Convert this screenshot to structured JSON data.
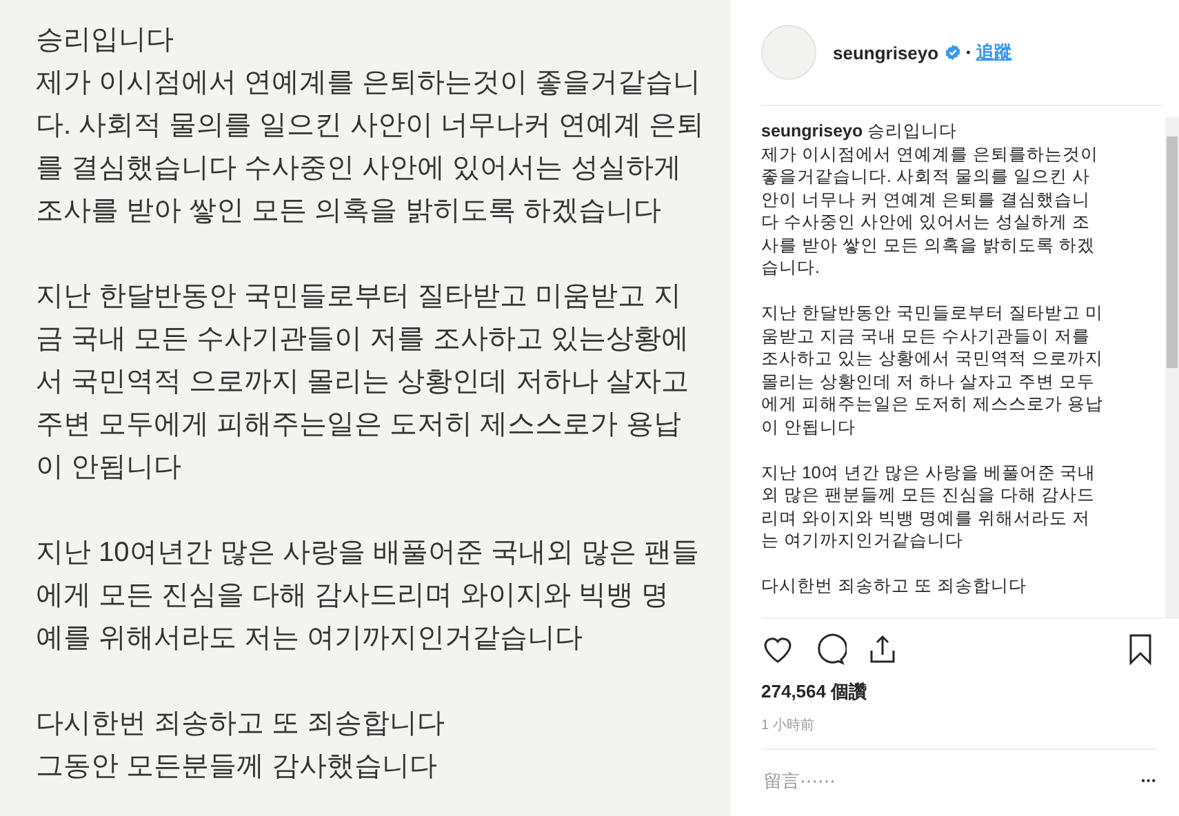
{
  "note_image": {
    "paragraphs": [
      [
        "승리입니다",
        "제가 이시점에서 연예계를 은퇴하는것이 좋을거같습니",
        "다. 사회적 물의를 일으킨 사안이 너무나커 연예계 은퇴",
        "를 결심했습니다 수사중인 사안에 있어서는 성실하게",
        "조사를 받아 쌓인 모든 의혹을 밝히도록 하겠습니다"
      ],
      [
        "지난 한달반동안 국민들로부터 질타받고 미움받고 지",
        "금 국내 모든 수사기관들이 저를 조사하고 있는상황에",
        "서 국민역적 으로까지 몰리는 상황인데 저하나 살자고",
        "주변 모두에게 피해주는일은 도저히 제스스로가 용납",
        "이 안됩니다"
      ],
      [
        "지난 10여년간 많은 사랑을 배풀어준 국내외 많은 팬들",
        "에게 모든 진심을 다해 감사드리며   와이지와 빅뱅 명",
        "예를 위해서라도 저는 여기까지인거같습니다"
      ],
      [
        "다시한번 죄송하고 또 죄송합니다",
        "그동안 모든분들께 감사했습니다"
      ]
    ]
  },
  "header": {
    "username": "seungriseyo",
    "verified": true,
    "separator": "•",
    "follow": "追蹤"
  },
  "caption": {
    "username": "seungriseyo",
    "paragraphs": [
      [
        "승리입니다",
        "제가 이시점에서 연예계를 은퇴를하는것이",
        "좋을거같습니다. 사회적 물의를 일으킨 사",
        "안이 너무나 커 연예계 은퇴를 결심했습니",
        "다 수사중인 사안에 있어서는 성실하게 조",
        "사를 받아 쌓인 모든 의혹을 밝히도록 하겠",
        "습니다."
      ],
      [
        "지난 한달반동안 국민들로부터 질타받고 미",
        "움받고 지금 국내 모든 수사기관들이 저를",
        "조사하고 있는 상황에서 국민역적 으로까지",
        "몰리는 상황인데 저 하나 살자고 주변 모두",
        "에게 피해주는일은 도저히 제스스로가 용납",
        "이 안됩니다"
      ],
      [
        "지난 10여 년간 많은 사랑을 베풀어준 국내",
        "외 많은 팬분들께 모든 진심을 다해 감사드",
        "리며 와이지와 빅뱅 명예를 위해서라도 저",
        "는 여기까지인거같습니다"
      ],
      [
        "다시한번 죄송하고 또 죄송합니다"
      ]
    ]
  },
  "likes": "274,564 個讚",
  "time": "1 小時前",
  "comment": {
    "placeholder": "留言⋯⋯",
    "more": "•••"
  }
}
